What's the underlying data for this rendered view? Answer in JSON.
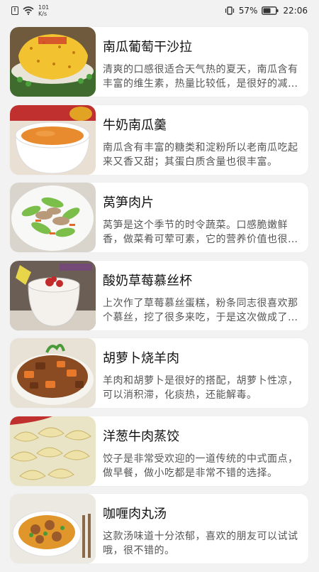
{
  "status_bar": {
    "net_speed_value": "101",
    "net_speed_unit": "K/s",
    "battery_percent": "57%",
    "time": "22:06"
  },
  "recipes": [
    {
      "title": "南瓜葡萄干沙拉",
      "desc": "清爽的口感很适合天气热的夏天，南瓜含有丰富的维生素，热量比较低，是很好的减肥食品。",
      "image": "pumpkin-raisin-salad"
    },
    {
      "title": "牛奶南瓜羹",
      "desc": "南瓜含有丰富的糖类和淀粉所以老南瓜吃起来又香又甜；其蛋白质含量也很丰富。",
      "image": "milk-pumpkin-soup"
    },
    {
      "title": "莴笋肉片",
      "desc": "莴笋是这个季节的时令蔬菜。口感脆嫩鲜香，做菜肴可荤可素，它的营养价值也很高。",
      "image": "lettuce-pork-slices"
    },
    {
      "title": "酸奶草莓慕丝杯",
      "desc": "上次作了草莓慕丝蛋糕，粉条同志很喜欢那个慕丝，挖了很多来吃，于是这次做成了杯子。",
      "image": "yogurt-strawberry-mousse"
    },
    {
      "title": "胡萝卜烧羊肉",
      "desc": "羊肉和胡萝卜是很好的搭配，胡萝卜性凉，可以消积滞，化痰热，还能解毒。",
      "image": "carrot-braised-lamb"
    },
    {
      "title": "洋葱牛肉蒸饺",
      "desc": "饺子是非常受欢迎的一道传统的中式面点，做早餐，做小吃都是非常不错的选择。",
      "image": "onion-beef-dumplings"
    },
    {
      "title": "咖喱肉丸汤",
      "desc": "这款汤味道十分浓郁，喜欢的朋友可以试试哦，很不错的。",
      "image": "curry-meatball-soup"
    }
  ]
}
